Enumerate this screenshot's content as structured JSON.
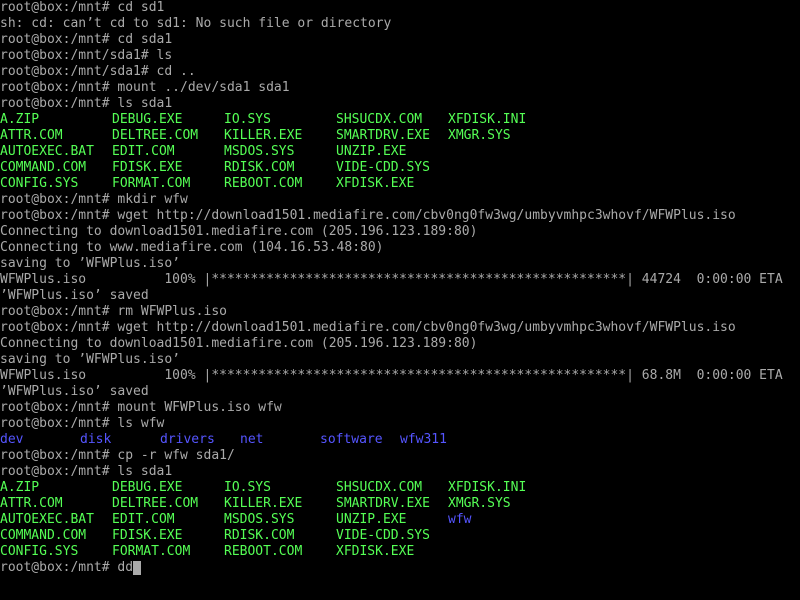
{
  "terminal": {
    "lines": [
      "root@box:/mnt# cd sd1",
      "sh: cd: can’t cd to sd1: No such file or directory",
      "root@box:/mnt# cd sda1",
      "root@box:/mnt/sda1# ls",
      "root@box:/mnt/sda1# cd ..",
      "root@box:/mnt# mount ../dev/sda1 sda1",
      "root@box:/mnt# ls sda1"
    ],
    "ls_sda1_first": [
      [
        "A.ZIP",
        "DEBUG.EXE",
        "IO.SYS",
        "SHSUCDX.COM",
        "XFDISK.INI"
      ],
      [
        "ATTR.COM",
        "DELTREE.COM",
        "KILLER.EXE",
        "SMARTDRV.EXE",
        "XMGR.SYS"
      ],
      [
        "AUTOEXEC.BAT",
        "EDIT.COM",
        "MSDOS.SYS",
        "UNZIP.EXE",
        ""
      ],
      [
        "COMMAND.COM",
        "FDISK.EXE",
        "RDISK.COM",
        "VIDE-CDD.SYS",
        ""
      ],
      [
        "CONFIG.SYS",
        "FORMAT.COM",
        "REBOOT.COM",
        "XFDISK.EXE",
        ""
      ]
    ],
    "lines2": [
      "root@box:/mnt# mkdir wfw",
      "root@box:/mnt# wget http://download1501.mediafire.com/cbv0ng0fw3wg/umbyvmhpc3whovf/WFWPlus.iso",
      "Connecting to download1501.mediafire.com (205.196.123.189:80)",
      "Connecting to www.mediafire.com (104.16.53.48:80)",
      "saving to ’WFWPlus.iso’",
      "WFWPlus.iso          100% |*****************************************************| 44724  0:00:00 ETA",
      "’WFWPlus.iso’ saved",
      "root@box:/mnt# rm WFWPlus.iso",
      "root@box:/mnt# wget http://download1501.mediafire.com/cbv0ng0fw3wg/umbyvmhpc3whovf/WFWPlus.iso",
      "Connecting to download1501.mediafire.com (205.196.123.189:80)",
      "saving to ’WFWPlus.iso’",
      "WFWPlus.iso          100% |*****************************************************| 68.8M  0:00:00 ETA",
      "’WFWPlus.iso’ saved",
      "root@box:/mnt# mount WFWPlus.iso wfw",
      "root@box:/mnt# ls wfw"
    ],
    "ls_wfw": [
      "dev",
      "disk",
      "drivers",
      "net",
      "software",
      "wfw311"
    ],
    "lines3": [
      "root@box:/mnt# cp -r wfw sda1/",
      "root@box:/mnt# ls sda1"
    ],
    "ls_sda1_second": [
      [
        "A.ZIP",
        "DEBUG.EXE",
        "IO.SYS",
        "SHSUCDX.COM",
        "XFDISK.INI"
      ],
      [
        "ATTR.COM",
        "DELTREE.COM",
        "KILLER.EXE",
        "SMARTDRV.EXE",
        "XMGR.SYS"
      ],
      [
        "AUTOEXEC.BAT",
        "EDIT.COM",
        "MSDOS.SYS",
        "UNZIP.EXE",
        "wfw"
      ],
      [
        "COMMAND.COM",
        "FDISK.EXE",
        "RDISK.COM",
        "VIDE-CDD.SYS",
        ""
      ],
      [
        "CONFIG.SYS",
        "FORMAT.COM",
        "REBOOT.COM",
        "XFDISK.EXE",
        ""
      ]
    ],
    "prompt_line": "root@box:/mnt# dd"
  },
  "colors": {
    "background": "#000000",
    "text": "#aaaaaa",
    "file": "#55ff55",
    "directory": "#5555ff"
  }
}
